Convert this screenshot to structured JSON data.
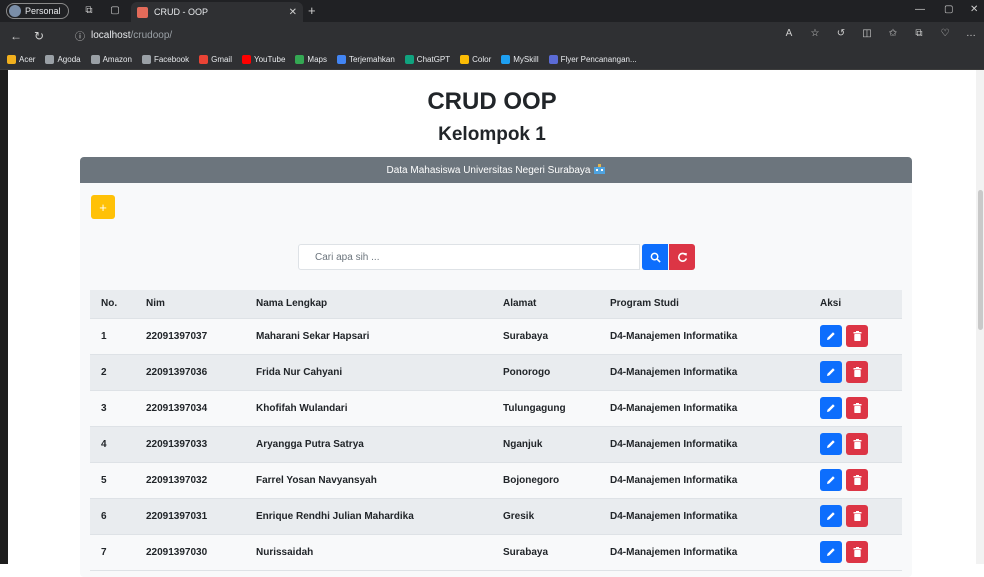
{
  "browser": {
    "profile_label": "Personal",
    "tab_title": "CRUD - OOP",
    "url_host": "localhost",
    "url_path": "/crudoop/",
    "bookmarks": [
      {
        "label": "Acer",
        "color": "#f2b01e"
      },
      {
        "label": "Agoda",
        "color": "#9aa0a6"
      },
      {
        "label": "Amazon",
        "color": "#9aa0a6"
      },
      {
        "label": "Facebook",
        "color": "#9aa0a6"
      },
      {
        "label": "Gmail",
        "color": "#ea4335"
      },
      {
        "label": "YouTube",
        "color": "#ff0000"
      },
      {
        "label": "Maps",
        "color": "#34a853"
      },
      {
        "label": "Terjemahkan",
        "color": "#4285f4"
      },
      {
        "label": "ChatGPT",
        "color": "#10a37f"
      },
      {
        "label": "Color",
        "color": "#fbbc05"
      },
      {
        "label": "MySkill",
        "color": "#1ea0f2"
      },
      {
        "label": "Flyer Pencanangan...",
        "color": "#5b6bd6"
      }
    ]
  },
  "page": {
    "title": "CRUD OOP",
    "subtitle": "Kelompok 1",
    "card_header": "Data Mahasiswa Universitas Negeri Surabaya",
    "add_icon": "+",
    "search": {
      "placeholder": "Cari apa sih ..."
    },
    "table": {
      "headers": [
        "No.",
        "Nim",
        "Nama Lengkap",
        "Alamat",
        "Program Studi",
        "Aksi"
      ],
      "rows": [
        {
          "no": "1",
          "nim": "22091397037",
          "nama": "Maharani Sekar Hapsari",
          "alamat": "Surabaya",
          "prodi": "D4-Manajemen Informatika"
        },
        {
          "no": "2",
          "nim": "22091397036",
          "nama": "Frida Nur Cahyani",
          "alamat": "Ponorogo",
          "prodi": "D4-Manajemen Informatika"
        },
        {
          "no": "3",
          "nim": "22091397034",
          "nama": "Khofifah Wulandari",
          "alamat": "Tulungagung",
          "prodi": "D4-Manajemen Informatika"
        },
        {
          "no": "4",
          "nim": "22091397033",
          "nama": "Aryangga Putra Satrya",
          "alamat": "Nganjuk",
          "prodi": "D4-Manajemen Informatika"
        },
        {
          "no": "5",
          "nim": "22091397032",
          "nama": "Farrel Yosan Navyansyah",
          "alamat": "Bojonegoro",
          "prodi": "D4-Manajemen Informatika"
        },
        {
          "no": "6",
          "nim": "22091397031",
          "nama": "Enrique Rendhi Julian Mahardika",
          "alamat": "Gresik",
          "prodi": "D4-Manajemen Informatika"
        },
        {
          "no": "7",
          "nim": "22091397030",
          "nama": "Nurissaidah",
          "alamat": "Surabaya",
          "prodi": "D4-Manajemen Informatika"
        }
      ]
    }
  },
  "colors": {
    "primary": "#0d6efd",
    "danger": "#dc3545",
    "warning": "#ffc107",
    "header": "#6c757d"
  }
}
